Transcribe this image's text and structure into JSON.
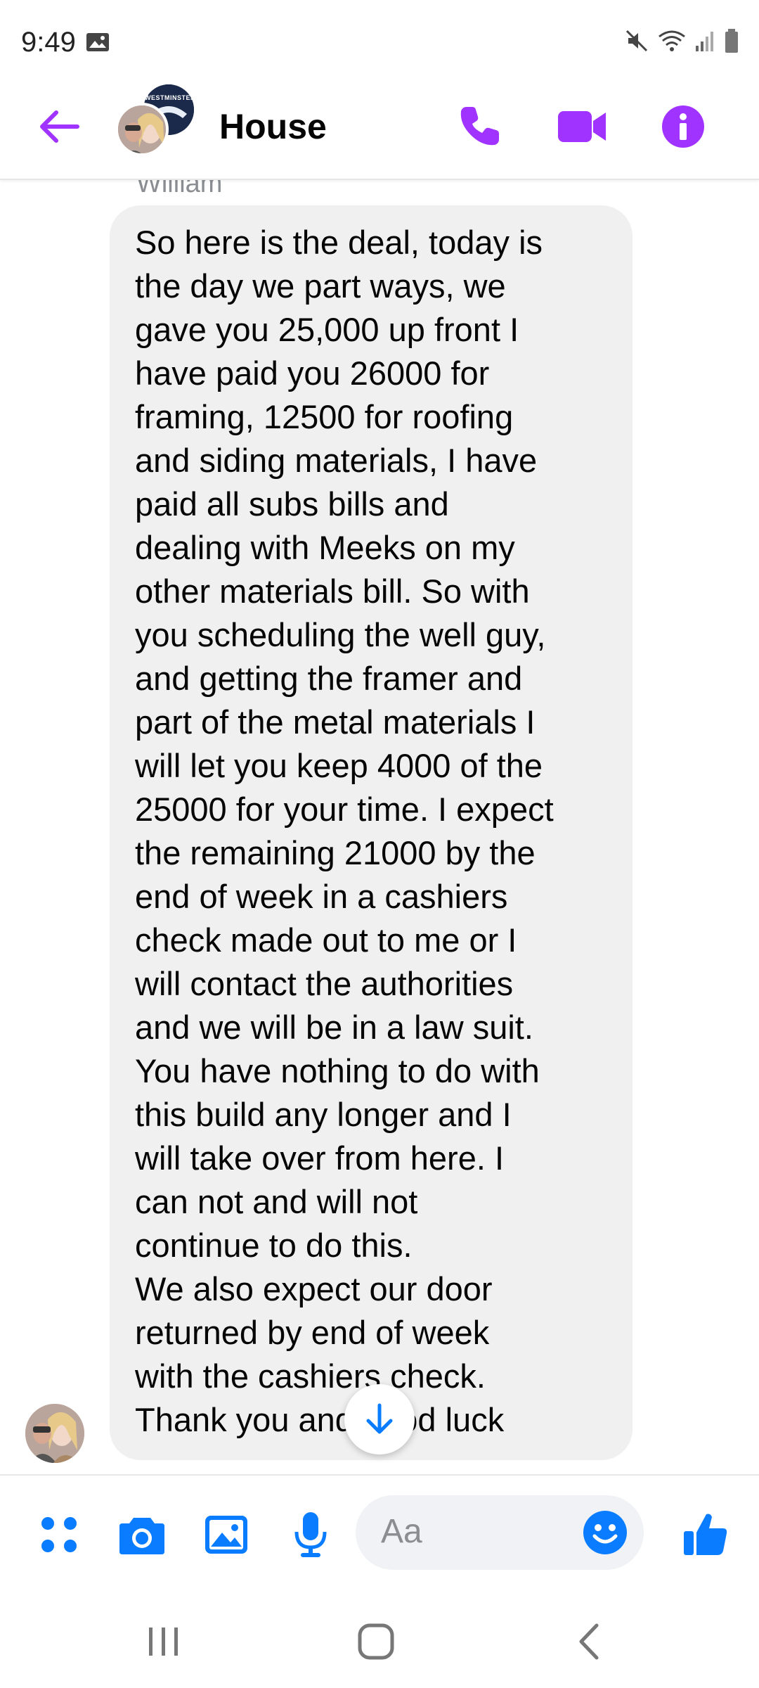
{
  "status_bar": {
    "time": "9:49"
  },
  "header": {
    "title": "House",
    "group_avatar_badge": "WESTMINSTER"
  },
  "conversation": {
    "sender_name": "William",
    "message_text": "So here is the deal, today is\nthe day we part ways, we\ngave you 25,000 up front I\nhave paid you 26000 for\nframing, 12500 for roofing\nand siding materials, I have\npaid all subs bills and\ndealing with Meeks on my\nother materials bill. So with\nyou scheduling the well guy,\nand getting the framer and\npart of the metal materials I\nwill let you keep 4000 of the\n25000 for your time. I expect\nthe remaining 21000 by the\nend of week in a cashiers\ncheck made out to me or I\nwill contact the authorities\nand we will be in a law suit.\nYou have nothing to do with\nthis build any longer and I\nwill take over from here. I\ncan not and will not\ncontinue to do this.\nWe also expect our door\nreturned by end of week\nwith the cashiers check.\nThank you and good luck"
  },
  "composer": {
    "placeholder": "Aa"
  },
  "icons": {
    "back": "back-arrow-icon",
    "call": "phone-icon",
    "video": "video-camera-icon",
    "info": "info-icon",
    "menu": "four-dots-icon",
    "camera": "camera-icon",
    "gallery": "image-icon",
    "mic": "microphone-icon",
    "emoji": "emoji-icon",
    "like": "thumbs-up-icon",
    "scroll": "arrow-down-icon"
  },
  "colors": {
    "header_accent": "#a033ff",
    "composer_accent": "#0a7cff",
    "bubble_bg": "#f0f0f0"
  }
}
